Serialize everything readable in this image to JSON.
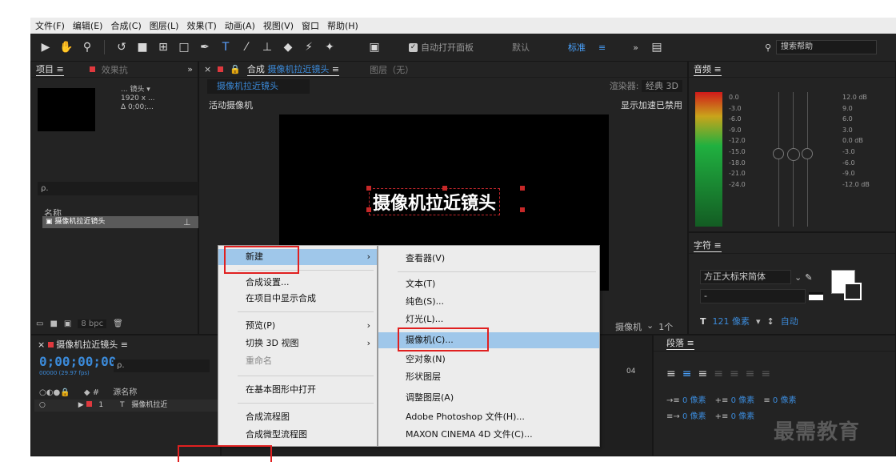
{
  "menubar": {
    "items": [
      "文件(F)",
      "编辑(E)",
      "合成(C)",
      "图层(L)",
      "效果(T)",
      "动画(A)",
      "视图(V)",
      "窗口",
      "帮助(H)"
    ]
  },
  "toolbar": {
    "auto_open_label": "自动打开面板",
    "workspace_default": "默认",
    "workspace_standard": "标准",
    "workspace_menu": "≡",
    "expand_glyph": "»",
    "search_placeholder": "搜索帮助"
  },
  "project_panel": {
    "tab_label": "项目 ≡",
    "effects_tab": "效果抗",
    "overflow_glyph": "»",
    "info_name": "... 镜头 ▾",
    "info_size": "1920 x ...",
    "info_duration": "Δ 0;00;...",
    "search_placeholder": "ρ.",
    "list_header": "名称",
    "list_item": "摄像机拉近镜头",
    "footer_bpc": "8 bpc"
  },
  "composition_panel": {
    "tab_label": "合成",
    "tab_name": "摄像机拉近镜头",
    "tab_menu": "≡",
    "layer_tab": "图层（无）",
    "comp_tab_chip": "摄像机拉近镜头",
    "renderer_label": "渲染器:",
    "renderer_value": "经典 3D",
    "active_camera": "活动摄像机",
    "gpu_notice": "显示加速已禁用",
    "title_text": "摄像机拉近镜头",
    "camera_select": "摄像机",
    "views_select": "1个"
  },
  "audio_panel": {
    "title": "音频 ≡",
    "scale_left": [
      "0.0",
      "-3.0",
      "-6.0",
      "-9.0",
      "-12.0",
      "-15.0",
      "-18.0",
      "-21.0",
      "-24.0"
    ],
    "scale_right": [
      "12.0 dB",
      "9.0",
      "6.0",
      "3.0",
      "0.0 dB",
      "-3.0",
      "-6.0",
      "-9.0",
      "-12.0 dB"
    ]
  },
  "character_panel": {
    "title": "字符 ≡",
    "font_name": "方正大标宋简体",
    "font_style": "-",
    "size_glyph": "T",
    "size_value": "121 像素",
    "leading_value": "自动"
  },
  "paragraph_panel": {
    "title": "段落 ≡",
    "indent_left": "0 像素",
    "space_before": "0 像素",
    "indent_first": "0 像素",
    "indent_right": "0 像素",
    "space_after": "0 像素"
  },
  "timeline_panel": {
    "tab_label": "摄像机拉近镜头 ≡",
    "timecode": "0;00;00;00",
    "fps_info": "00000 (29.97 fps)",
    "search_placeholder": "ρ.",
    "col_source": "源名称",
    "layer_index": "1",
    "layer_type": "T",
    "layer_name": "摄像机拉近",
    "ruler_mark": "04"
  },
  "context_menu": {
    "main_items": [
      {
        "label": "新建",
        "submenu": true
      },
      {
        "label": "合成设置..."
      },
      {
        "label": "在项目中显示合成"
      },
      {
        "label": "预览(P)",
        "submenu": true
      },
      {
        "label": "切换 3D 视图",
        "submenu": true
      },
      {
        "label": "重命名",
        "disabled": true
      },
      {
        "label": "在基本图形中打开"
      },
      {
        "label": "合成流程图"
      },
      {
        "label": "合成微型流程图"
      }
    ],
    "submenu_items": [
      "查看器(V)",
      "文本(T)",
      "纯色(S)...",
      "灯光(L)...",
      "摄像机(C)...",
      "空对象(N)",
      "形状图层",
      "调整图层(A)",
      "Adobe Photoshop 文件(H)...",
      "MAXON CINEMA 4D 文件(C)..."
    ],
    "arrow_glyph": "›"
  },
  "watermark": "最需教育",
  "colors": {
    "accent_blue": "#3b8ad9",
    "highlight": "#9fc7ea",
    "annotation_red": "#e02020",
    "panel_bg": "#232323"
  }
}
